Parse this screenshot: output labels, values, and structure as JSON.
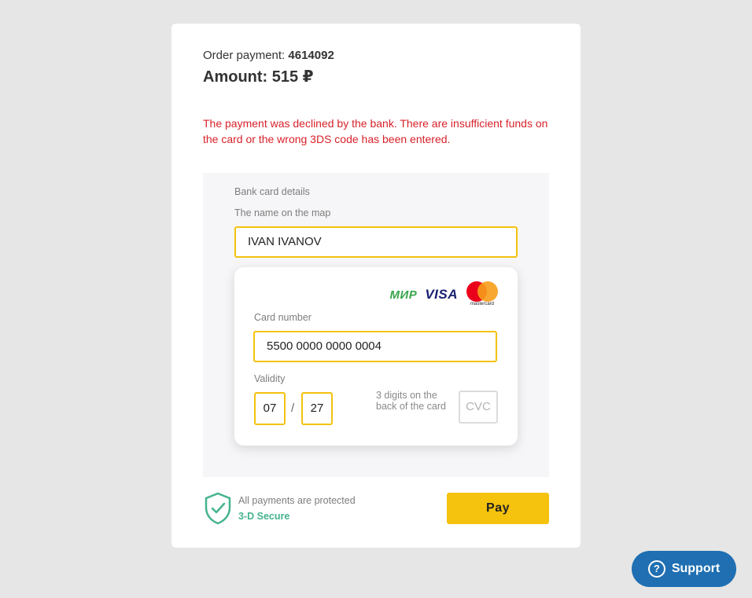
{
  "order": {
    "label": "Order payment:",
    "number": "4614092",
    "amount_text": "Amount: 515 ₽"
  },
  "error_message": "The payment was declined by the bank. There are insufficient funds on the card or the wrong 3DS code has been entered.",
  "form": {
    "section_title": "Bank card details",
    "name_label": "The name on the map",
    "name_value": "IVAN IVANOV",
    "brands": {
      "mir": "МИР",
      "visa": "VISA",
      "mastercard": "mastercard"
    },
    "card_number_label": "Card number",
    "card_number_value": "5500 0000 0000 0004",
    "validity_label": "Validity",
    "month": "07",
    "separator": "/",
    "year": "27",
    "cvc_hint": "3 digits on the back of the card",
    "cvc_placeholder": "CVC"
  },
  "security": {
    "text": "All payments are protected",
    "badge": "3-D Secure",
    "icon": "shield-check-icon",
    "color": "#45b38f"
  },
  "pay_button": "Pay",
  "support_button": {
    "icon_glyph": "?",
    "label": "Support"
  },
  "colors": {
    "accent": "#f5c20d",
    "error": "#d8222a",
    "support": "#1f6fb2"
  }
}
